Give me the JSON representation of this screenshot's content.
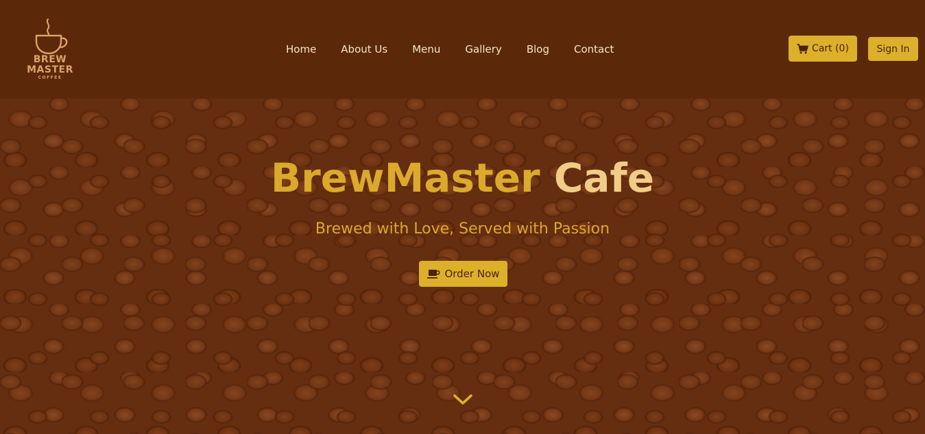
{
  "logo": {
    "line1": "BREW",
    "line2": "MASTER",
    "line3": "COFFEE",
    "icon": "coffee-cup-icon"
  },
  "nav": {
    "items": [
      {
        "label": "Home"
      },
      {
        "label": "About Us"
      },
      {
        "label": "Menu"
      },
      {
        "label": "Gallery"
      },
      {
        "label": "Blog"
      },
      {
        "label": "Contact"
      }
    ]
  },
  "header_actions": {
    "cart_label": "Cart (0)",
    "cart_icon": "shopping-cart-icon",
    "signin_label": "Sign In"
  },
  "hero": {
    "title_part1": "BrewMaster",
    "title_part2": "Cafe",
    "subtitle": "Brewed with Love, Served with Passion",
    "order_label": "Order Now",
    "order_icon": "mug-icon",
    "scroll_icon": "chevron-down-icon"
  },
  "colors": {
    "header_bg": "#5c280a",
    "accent": "#ddb02b",
    "accent_text": "#4a2206",
    "title_light": "#f1cc86",
    "nav_text": "#f5e6c6"
  }
}
